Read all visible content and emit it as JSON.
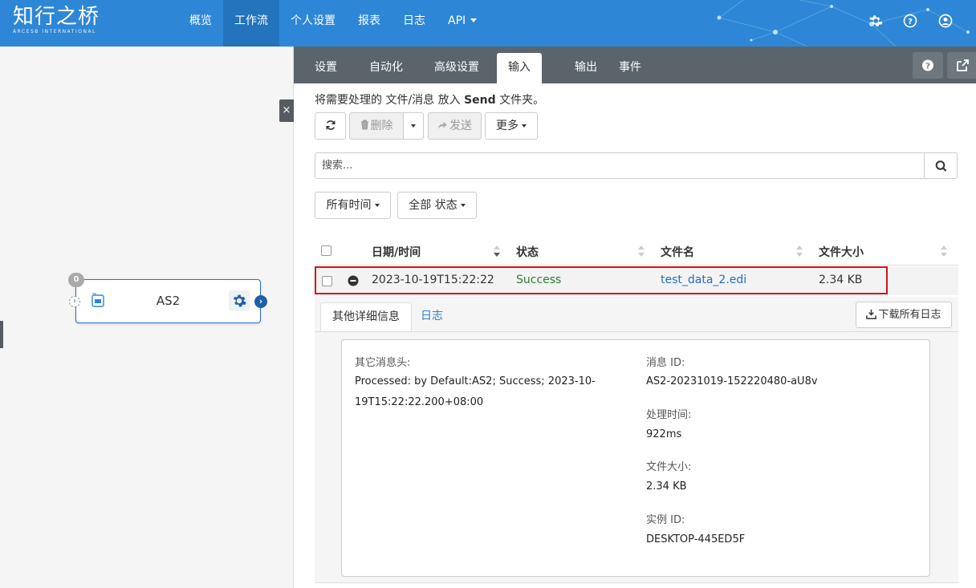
{
  "brand": {
    "name_cn": "知行之桥",
    "name_en": "ARCESB INTERNATIONAL"
  },
  "nav": {
    "items": [
      "概览",
      "工作流",
      "个人设置",
      "报表",
      "日志",
      "API"
    ],
    "active": "工作流"
  },
  "top_icons": [
    "gear-icon",
    "help-circle-icon",
    "user-circle-icon"
  ],
  "flow": {
    "node_title": "AS2",
    "badge_count": "0",
    "collapse_label": "×"
  },
  "tabs": {
    "items": [
      "设置",
      "自动化",
      "高级设置",
      "输入",
      "输出",
      "事件"
    ],
    "active": "输入"
  },
  "hint": {
    "prefix": "将需要处理的 文件/消息 放入 ",
    "folder": "Send",
    "suffix": " 文件夹。"
  },
  "toolbar": {
    "delete_label": "删除",
    "send_label": "发送",
    "more_label": "更多"
  },
  "search": {
    "placeholder": "搜索..."
  },
  "filters": {
    "time_label": "所有时间",
    "status_label": "全部 状态"
  },
  "table": {
    "columns": [
      "日期/时间",
      "状态",
      "文件名",
      "文件大小"
    ],
    "rows": [
      {
        "datetime": "2023-10-19T15:22:22",
        "status": "Success",
        "filename": "test_data_2.edi",
        "size": "2.34 KB"
      }
    ]
  },
  "detail": {
    "tabs": [
      "其他详细信息",
      "日志"
    ],
    "download_label": "下载所有日志",
    "headers_label": "其它消息头:",
    "headers_value_line1": "Processed: by Default:AS2; Success; 2023-10-",
    "headers_value_line2": "19T15:22:22.200+08:00",
    "message_id_label": "消息 ID:",
    "message_id": "AS2-20231019-152220480-aU8v",
    "processing_time_label": "处理时间:",
    "processing_time": "922ms",
    "file_size_label": "文件大小:",
    "file_size": "2.34 KB",
    "instance_id_label": "实例 ID:",
    "instance_id": "DESKTOP-445ED5F"
  },
  "colors": {
    "topbar": "#2e86d6",
    "tabbar": "#5b636b",
    "success": "#2e7d32",
    "link": "#1f6fbf",
    "highlight": "#d2141c"
  }
}
